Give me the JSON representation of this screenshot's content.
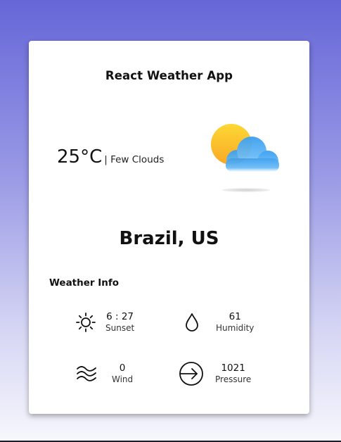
{
  "app": {
    "title": "React Weather App"
  },
  "weather": {
    "temperature": "25°C",
    "condition": "| Few Clouds",
    "icon": "sun-behind-cloud-icon"
  },
  "location": {
    "city": "Brazil, US"
  },
  "info": {
    "heading": "Weather Info",
    "items": [
      {
        "icon": "sun-icon",
        "value": "6 : 27",
        "label": "Sunset"
      },
      {
        "icon": "water-drop-icon",
        "value": "61",
        "label": "Humidity"
      },
      {
        "icon": "wind-icon",
        "value": "0",
        "label": "Wind"
      },
      {
        "icon": "pressure-arrow-icon",
        "value": "1021",
        "label": "Pressure"
      }
    ]
  },
  "colors": {
    "background_top": "#6666d8",
    "background_bottom": "#f7f7fd",
    "card": "#ffffff",
    "sun": "#fbb525",
    "cloud": "#49a9f2"
  }
}
